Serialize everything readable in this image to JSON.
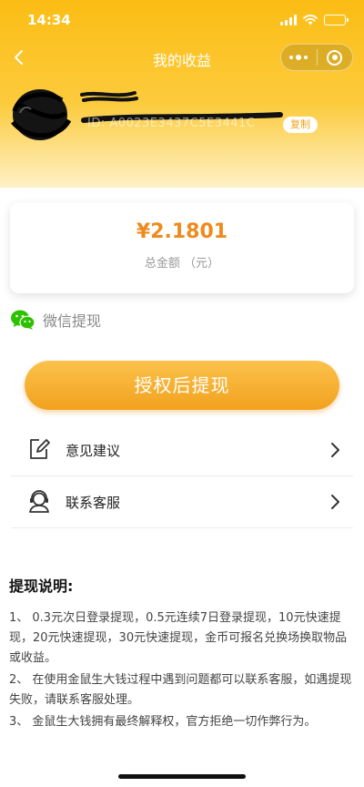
{
  "status_bar": {
    "time": "14:34"
  },
  "nav": {
    "title": "我的收益"
  },
  "user": {
    "id_text": "ID: A0023E3437C5E3441C",
    "copy_label": "复制"
  },
  "balance": {
    "amount": "¥2.1801",
    "label": "总金额 （元）"
  },
  "wechat": {
    "label": "微信提现"
  },
  "withdraw": {
    "button_label": "授权后提现"
  },
  "menu": {
    "items": [
      {
        "label": "意见建议",
        "icon": "edit-icon"
      },
      {
        "label": "联系客服",
        "icon": "customer-service-icon"
      }
    ]
  },
  "notes": {
    "title": "提现说明:",
    "items": [
      "1、 0.3元次日登录提现，0.5元连续7日登录提现，10元快速提现，20元快速提现，30元快速提现，金币可报名兑换场换取物品或收益。",
      "2、 在使用金鼠生大钱过程中遇到问题都可以联系客服，如遇提现失败，请联系客服处理。",
      "3、 金鼠生大钱拥有最终解释权，官方拒绝一切作弊行为。"
    ]
  },
  "colors": {
    "header_yellow": "#fbbd14",
    "amount_orange": "#ee8a1e",
    "button_orange": "#f2a11e",
    "wechat_green": "#2dc100"
  }
}
